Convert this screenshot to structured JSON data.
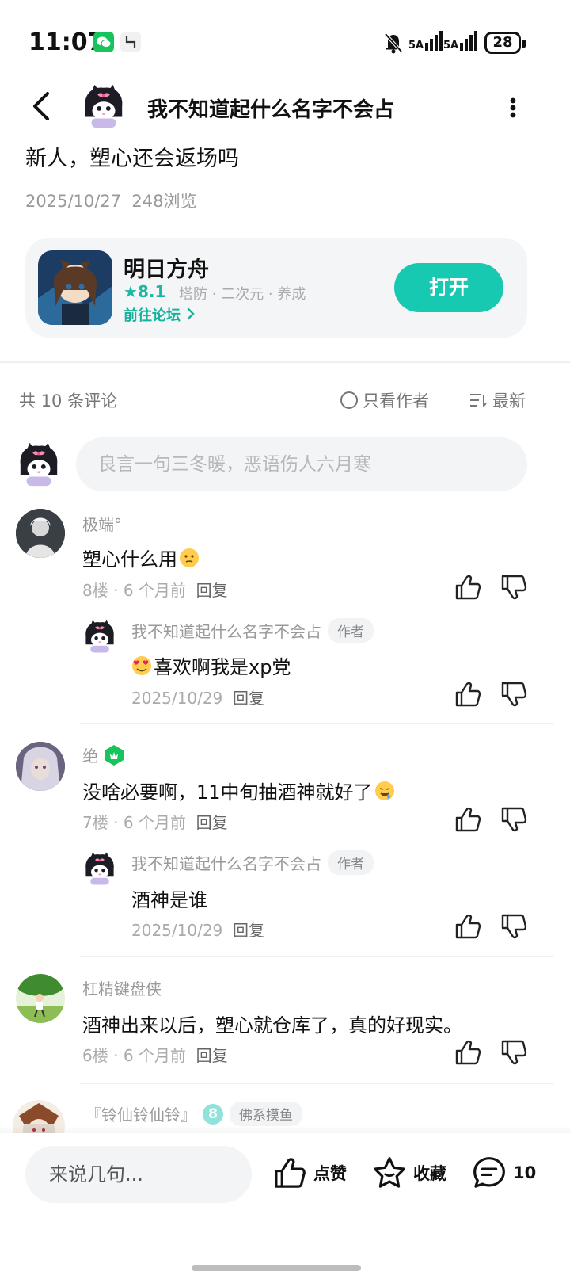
{
  "status_bar": {
    "time": "11:07",
    "network1": "5A",
    "network2": "5A",
    "battery": "28"
  },
  "header": {
    "author_name": "我不知道起什么名字不会占"
  },
  "post": {
    "title": "新人，塑心还会返场吗",
    "date": "2025/10/27",
    "views": "248浏览"
  },
  "app_card": {
    "name": "明日方舟",
    "rating": "8.1",
    "tags": "塔防 · 二次元 · 养成",
    "forum_link": "前往论坛",
    "open_label": "打开"
  },
  "comments_header": {
    "count": "共 10 条评论",
    "only_author": "只看作者",
    "sort": "最新"
  },
  "comment_input": {
    "placeholder": "良言一句三冬暖，恶语伤人六月寒"
  },
  "comments": [
    {
      "user": "极端°",
      "text": "塑心什么用",
      "floor": "8楼",
      "time": "6 个月前",
      "reply": "回复",
      "sub": {
        "user": "我不知道起什么名字不会占",
        "badge": "作者",
        "text": "喜欢啊我是xp党",
        "time": "2025/10/29",
        "reply": "回复"
      }
    },
    {
      "user": "绝",
      "text": "没啥必要啊，11中旬抽酒神就好了",
      "floor": "7楼",
      "time": "6 个月前",
      "reply": "回复",
      "sub": {
        "user": "我不知道起什么名字不会占",
        "badge": "作者",
        "text": "酒神是谁",
        "time": "2025/10/29",
        "reply": "回复"
      }
    },
    {
      "user": "杠精键盘侠",
      "text": "酒神出来以后，塑心就仓库了，真的好现实。",
      "floor": "6楼",
      "time": "6 个月前",
      "reply": "回复"
    },
    {
      "user": "『铃仙铃仙铃』",
      "level": "8",
      "tag": "佛系摸鱼"
    }
  ],
  "bottom_bar": {
    "input_placeholder": "来说几句...",
    "like_label": "点赞",
    "fav_label": "收藏",
    "comment_count": "10"
  },
  "colors": {
    "accent": "#17c9b0",
    "accent_text": "#15b39d",
    "muted": "#999999"
  }
}
